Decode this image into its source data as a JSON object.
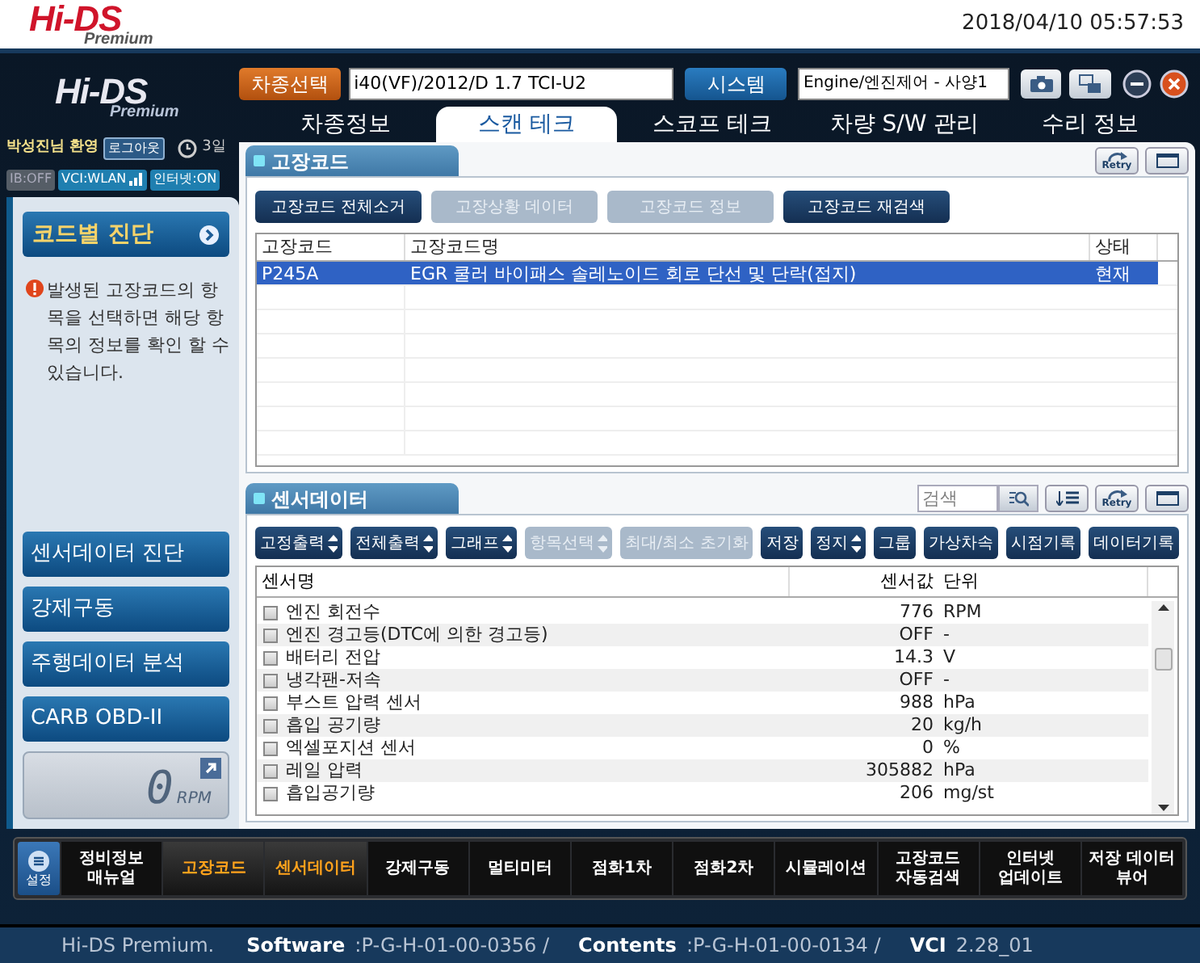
{
  "header_logo": {
    "name": "Hi-DS",
    "subtitle": "Premium"
  },
  "datetime": "2018/04/10 05:57:53",
  "side_logo": {
    "name": "Hi-DS",
    "subtitle": "Premium"
  },
  "top_bar": {
    "vehicle_button": "차종선택",
    "vehicle_value": "i40(VF)/2012/D 1.7 TCI-U2",
    "system_button": "시스템",
    "system_value": "Engine/엔진제어 - 사양1"
  },
  "main_tabs": [
    {
      "label": "차종정보",
      "selected": false
    },
    {
      "label": "스캔 테크",
      "selected": true
    },
    {
      "label": "스코프 테크",
      "selected": false
    },
    {
      "label": "차량 S/W 관리",
      "selected": false
    },
    {
      "label": "수리 정보",
      "selected": false
    }
  ],
  "user": {
    "greeting": "박성진님 환영",
    "logout": "로그아웃",
    "days": "3일"
  },
  "connection_badges": [
    {
      "label": "IB:OFF",
      "kind": "plain",
      "on": false
    },
    {
      "label": "VCI:WLAN",
      "kind": "wlan",
      "on": true
    },
    {
      "label": "인터넷:ON",
      "kind": "plain",
      "on": true
    }
  ],
  "side_panel": {
    "header": "코드별 진단",
    "note": "발생된 고장코드의 항목을 선택하면 해당 항목의 정보를 확인 할 수 있습니다.",
    "menu": [
      "센서데이터 진단",
      "강제구동",
      "주행데이터 분석",
      "CARB OBD-II"
    ],
    "gauge": {
      "value": "0",
      "unit": "RPM"
    }
  },
  "dtc_section": {
    "title": "고장코드",
    "retry_label": "Retry",
    "buttons": [
      {
        "label": "고장코드 전체소거",
        "disabled": false
      },
      {
        "label": "고장상황 데이터",
        "disabled": true
      },
      {
        "label": "고장코드 정보",
        "disabled": true
      },
      {
        "label": "고장코드 재검색",
        "disabled": false
      }
    ],
    "columns": [
      "고장코드",
      "고장코드명",
      "상태"
    ],
    "rows": [
      {
        "code": "P245A",
        "name": "EGR 쿨러 바이패스 솔레노이드 회로 단선 및 단락(접지)",
        "status": "현재",
        "selected": true
      }
    ]
  },
  "sensor_section": {
    "title": "센서데이터",
    "search_placeholder": "검색",
    "retry_label": "Retry",
    "buttons": [
      {
        "label": "고정출력",
        "kind": "dropdown",
        "disabled": false
      },
      {
        "label": "전체출력",
        "kind": "dropdown",
        "disabled": false
      },
      {
        "label": "그래프",
        "kind": "dropdown",
        "disabled": false
      },
      {
        "label": "항목선택",
        "kind": "dropdown",
        "disabled": true
      },
      {
        "label": "최대/최소 초기화",
        "kind": "plain",
        "disabled": true
      },
      {
        "label": "저장",
        "kind": "plain",
        "disabled": false
      },
      {
        "label": "정지",
        "kind": "dropdown",
        "disabled": false
      },
      {
        "label": "그룹",
        "kind": "plain",
        "disabled": false
      },
      {
        "label": "가상차속",
        "kind": "plain",
        "disabled": false
      },
      {
        "label": "시점기록",
        "kind": "plain",
        "disabled": false
      },
      {
        "label": "데이터기록",
        "kind": "plain",
        "disabled": false
      }
    ],
    "columns": [
      "센서명",
      "센서값",
      "단위"
    ],
    "rows": [
      {
        "name": "엔진 회전수",
        "value": "776",
        "unit": "RPM",
        "checked": false
      },
      {
        "name": "엔진 경고등(DTC에 의한 경고등)",
        "value": "OFF",
        "unit": "-",
        "checked": false
      },
      {
        "name": "배터리 전압",
        "value": "14.3",
        "unit": "V",
        "checked": false
      },
      {
        "name": "냉각팬-저속",
        "value": "OFF",
        "unit": "-",
        "checked": false
      },
      {
        "name": "부스트 압력 센서",
        "value": "988",
        "unit": "hPa",
        "checked": false
      },
      {
        "name": "흡입 공기량",
        "value": "20",
        "unit": "kg/h",
        "checked": false
      },
      {
        "name": "엑셀포지션 센서",
        "value": "0",
        "unit": "%",
        "checked": false
      },
      {
        "name": "레일 압력",
        "value": "305882",
        "unit": "hPa",
        "checked": false
      },
      {
        "name": "흡입공기량",
        "value": "206",
        "unit": "mg/st",
        "checked": false
      }
    ]
  },
  "bottom_toolbar": {
    "settings_label": "설정",
    "items": [
      {
        "label": "정비정보\n매뉴얼",
        "selected": false
      },
      {
        "label": "고장코드",
        "selected": true
      },
      {
        "label": "센서데이터",
        "selected": true
      },
      {
        "label": "강제구동",
        "selected": false
      },
      {
        "label": "멀티미터",
        "selected": false
      },
      {
        "label": "점화1차",
        "selected": false
      },
      {
        "label": "점화2차",
        "selected": false
      },
      {
        "label": "시뮬레이션",
        "selected": false
      },
      {
        "label": "고장코드\n자동검색",
        "selected": false
      },
      {
        "label": "인터넷\n업데이트",
        "selected": false
      },
      {
        "label": "저장 데이터\n뷰어",
        "selected": false
      }
    ]
  },
  "status_bar": {
    "product": "Hi-DS Premium.",
    "fields": [
      {
        "label": "Software",
        "value": ":P-G-H-01-00-0356 /"
      },
      {
        "label": "Contents",
        "value": ":P-G-H-01-00-0134 /"
      },
      {
        "label": "VCI",
        "value": "2.28_01"
      }
    ]
  }
}
